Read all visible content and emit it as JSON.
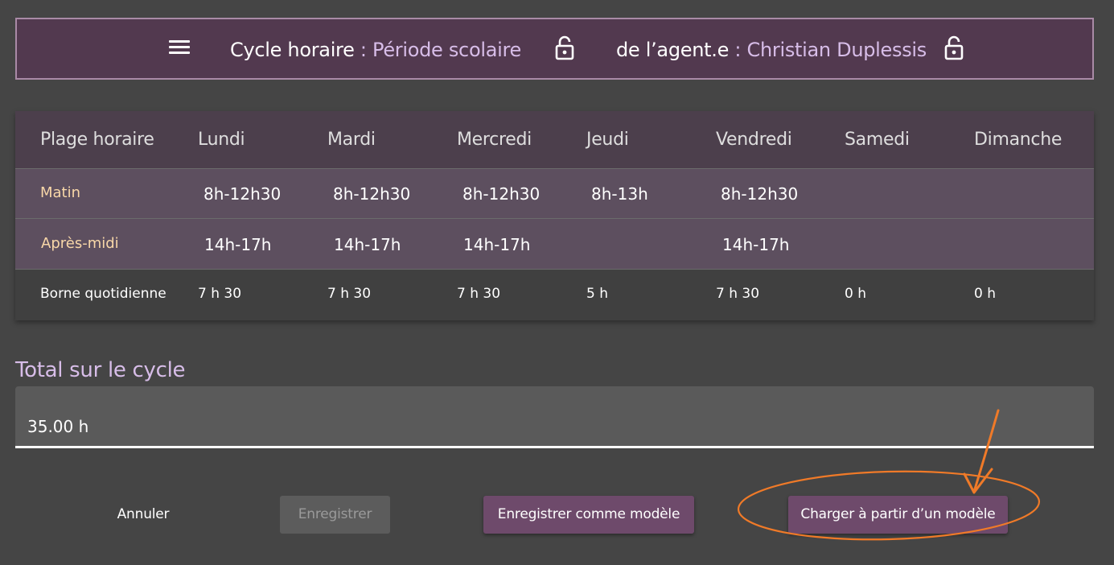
{
  "header": {
    "cycle_label": "Cycle horaire",
    "separator": " : ",
    "cycle_value": "Période scolaire",
    "agent_label": "de l’agent.e",
    "agent_value": "Christian Duplessis"
  },
  "table": {
    "columns": [
      "Plage horaire",
      "Lundi",
      "Mardi",
      "Mercredi",
      "Jeudi",
      "Vendredi",
      "Samedi",
      "Dimanche"
    ],
    "rows": [
      {
        "label": "Matin",
        "cells": [
          "8h-12h30",
          "8h-12h30",
          "8h-12h30",
          "8h-13h",
          "8h-12h30",
          "",
          ""
        ]
      },
      {
        "label": "Après-midi",
        "cells": [
          "14h-17h",
          "14h-17h",
          "14h-17h",
          "",
          "14h-17h",
          "",
          ""
        ]
      },
      {
        "label": "Borne quotidienne",
        "cells": [
          "7 h 30",
          "7 h 30",
          "7 h 30",
          "5 h",
          "7 h 30",
          "0 h",
          "0 h"
        ]
      }
    ]
  },
  "total": {
    "title": "Total sur le cycle",
    "value": "35.00 h"
  },
  "actions": {
    "cancel": "Annuler",
    "save": "Enregistrer",
    "save_as_model": "Enregistrer comme modèle",
    "load_from_model": "Charger à partir d’un modèle"
  },
  "icons": {
    "menu": "hamburger-menu-icon",
    "lock": "unlocked-padlock-icon"
  },
  "colors": {
    "header_bg": "#52394f",
    "accent_text": "#d7bde8",
    "row_label": "#f8d7a8",
    "primary_button": "#6e4a6b",
    "annotation": "#f07a28"
  }
}
